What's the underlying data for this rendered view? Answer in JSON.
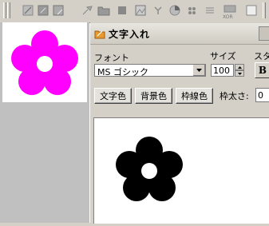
{
  "toolbar": {
    "icons": [
      "rect-select-icon",
      "fill-rect-icon",
      "rect-icon",
      "brush-icon",
      "folder-icon",
      "square-icon",
      "image-icon",
      "dropper-icon",
      "pie-icon",
      "dots-icon",
      "line-icon",
      "xor-icon",
      "blank-icon"
    ],
    "xor_label": "XOR"
  },
  "preview": {
    "flower_color": "#ff00ff"
  },
  "dialog": {
    "title": "文字入れ",
    "font_label": "フォント",
    "size_label": "サイズ",
    "style_label": "スタ",
    "font_value": "MS ゴシック",
    "size_value": "100",
    "bold_label": "B",
    "text_color_button": "文字色",
    "bg_color_button": "背景色",
    "frame_color_button": "枠線色",
    "frame_width_label": "枠太さ:",
    "frame_width_value": "0",
    "canvas_flower_color": "#000000"
  }
}
